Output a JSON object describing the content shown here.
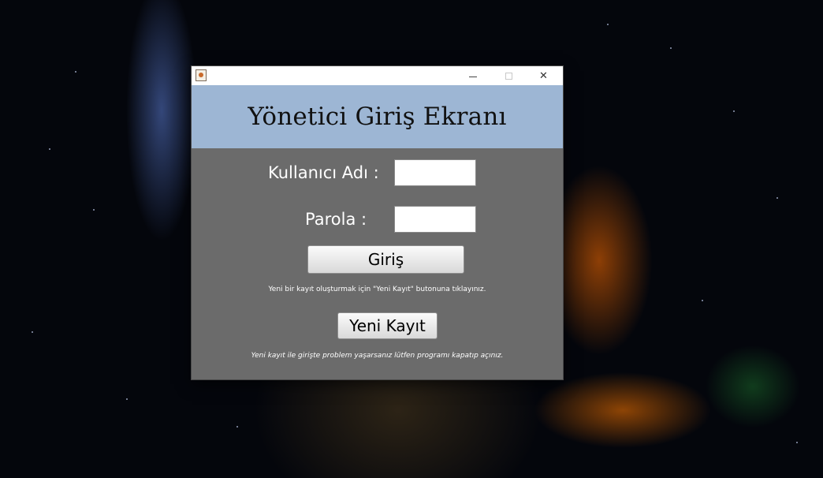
{
  "window": {
    "title": "",
    "app_icon": "java-app-icon",
    "controls": {
      "minimize": "minimize-icon",
      "maximize": "maximize-icon",
      "close": "close-icon",
      "close_glyph": "✕"
    }
  },
  "header": {
    "title": "Yönetici Giriş Ekranı"
  },
  "form": {
    "username_label": "Kullanıcı Adı :",
    "username_value": "",
    "password_label": "Parola :",
    "password_value": "",
    "login_button": "Giriş",
    "register_hint": "Yeni bir kayıt oluşturmak için \"Yeni Kayıt\" butonuna tıklayınız.",
    "register_button": "Yeni Kayıt",
    "problem_hint": "Yeni kayıt ile girişte problem yaşarsanız lütfen programı kapatıp açınız."
  },
  "colors": {
    "header_bg": "#9db6d4",
    "panel_bg": "#6b6b6b",
    "text_light": "#ffffff"
  }
}
